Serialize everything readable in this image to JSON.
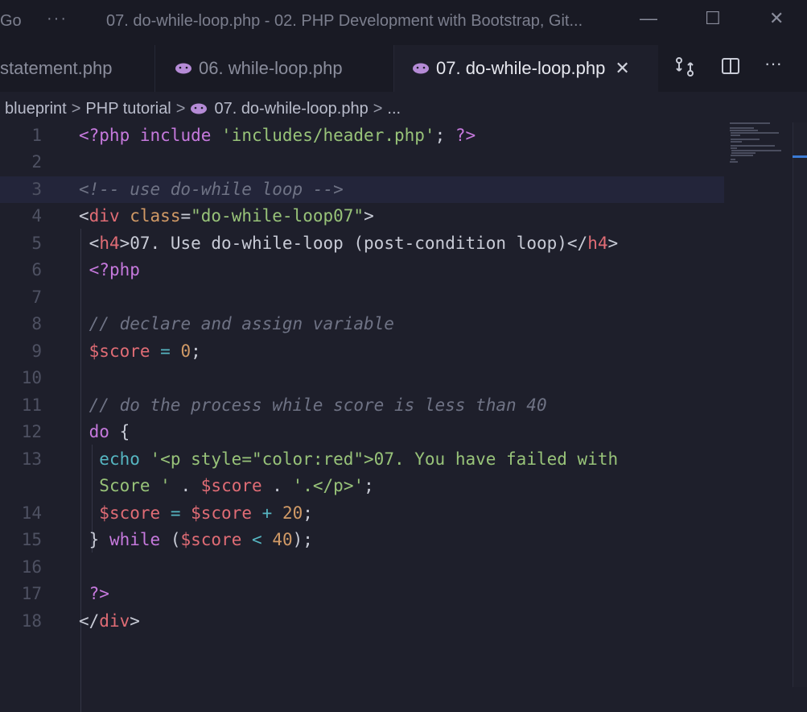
{
  "titlebar": {
    "menu_go": "Go",
    "dots": "···",
    "title": "07. do-while-loop.php - 02. PHP Development with Bootstrap, Git...",
    "minimize": "—",
    "maximize": "☐",
    "close": "✕"
  },
  "tabs": [
    {
      "label": "statement.php",
      "active": false,
      "icon": ""
    },
    {
      "label": "06. while-loop.php",
      "active": false,
      "icon": "php-elephant-icon"
    },
    {
      "label": "07. do-while-loop.php",
      "active": true,
      "icon": "php-elephant-icon",
      "close": "✕"
    }
  ],
  "tab_actions": {
    "compare_icon": "⇄",
    "split_icon": "◫",
    "more_icon": "···"
  },
  "breadcrumb": {
    "items": [
      "blueprint",
      "PHP tutorial",
      "07. do-while-loop.php",
      "..."
    ],
    "separator": ">"
  },
  "editor": {
    "line_numbers": [
      "1",
      "2",
      "3",
      "4",
      "5",
      "6",
      "7",
      "8",
      "9",
      "10",
      "11",
      "12",
      "13",
      "",
      "14",
      "15",
      "16",
      "17",
      "18"
    ],
    "current_line": 3
  },
  "colors": {
    "background": "#1e1f2b",
    "keyword": "#c679dd",
    "string": "#98c379",
    "tag": "#e06c75",
    "attr": "#d19a66",
    "comment": "#6f7385",
    "accent": "#3a7bd5"
  }
}
